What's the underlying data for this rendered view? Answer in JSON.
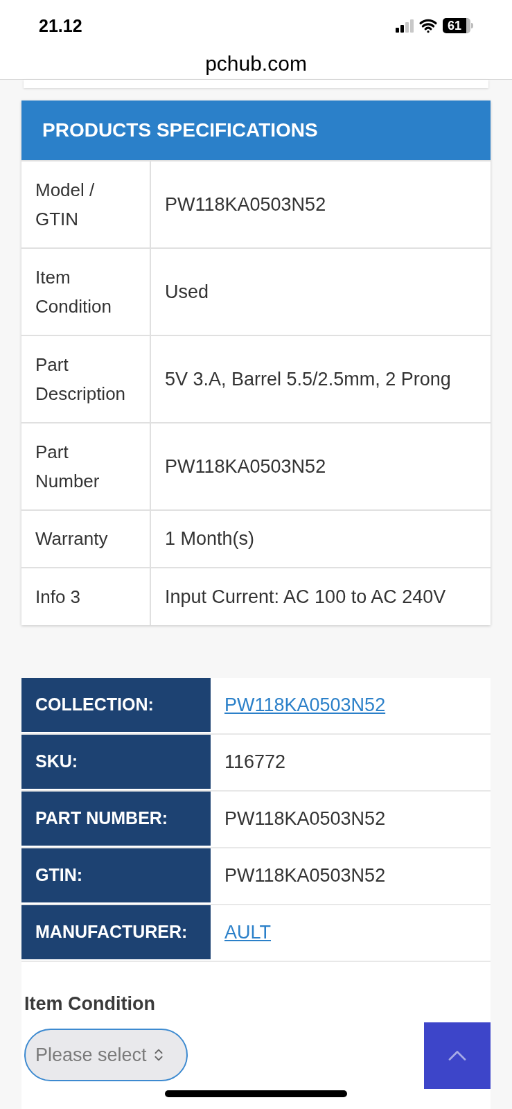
{
  "status_bar": {
    "time": "21.12",
    "battery": "61"
  },
  "address_bar": {
    "domain": "pchub.com"
  },
  "specifications": {
    "title": "PRODUCTS SPECIFICATIONS",
    "rows": [
      {
        "label": "Model / GTIN",
        "value": "PW118KA0503N52"
      },
      {
        "label": "Item Condition",
        "value": "Used"
      },
      {
        "label": "Part Description",
        "value": "5V 3.A, Barrel 5.5/2.5mm, 2 Prong"
      },
      {
        "label": "Part Number",
        "value": "PW118KA0503N52"
      },
      {
        "label": "Warranty",
        "value": "1 Month(s)"
      },
      {
        "label": "Info 3",
        "value": "Input Current: AC 100 to AC 240V"
      }
    ]
  },
  "details": [
    {
      "label": "COLLECTION:",
      "value": "PW118KA0503N52",
      "kind": "link"
    },
    {
      "label": "SKU:",
      "value": "116772",
      "kind": "text"
    },
    {
      "label": "PART NUMBER:",
      "value": "PW118KA0503N52",
      "kind": "text"
    },
    {
      "label": "GTIN:",
      "value": "PW118KA0503N52",
      "kind": "text"
    },
    {
      "label": "MANUFACTURER:",
      "value": "AULT",
      "kind": "link"
    }
  ],
  "item_condition": {
    "label": "Item Condition",
    "placeholder": "Please select"
  }
}
